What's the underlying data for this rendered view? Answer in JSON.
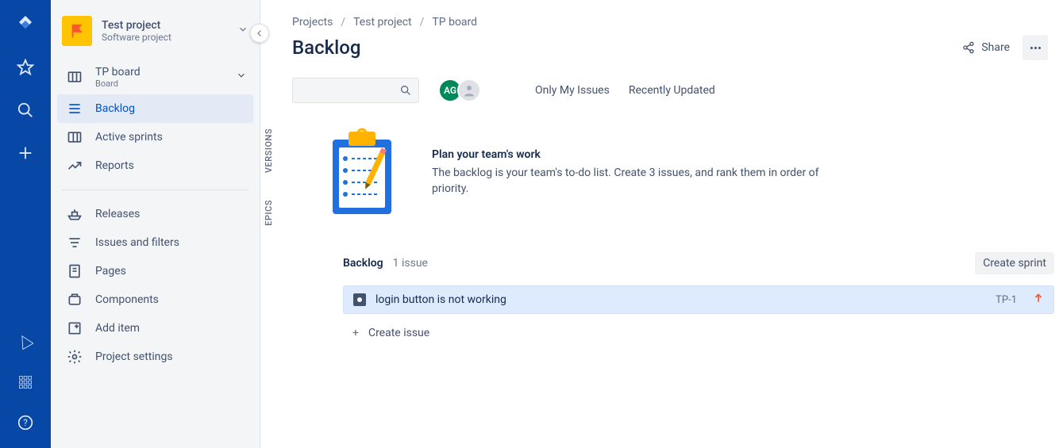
{
  "project": {
    "name": "Test project",
    "type": "Software project"
  },
  "board": {
    "name": "TP board",
    "type": "Board"
  },
  "sidebar": {
    "items": [
      {
        "label": "Backlog"
      },
      {
        "label": "Active sprints"
      },
      {
        "label": "Reports"
      }
    ],
    "secondary": [
      {
        "label": "Releases"
      },
      {
        "label": "Issues and filters"
      },
      {
        "label": "Pages"
      },
      {
        "label": "Components"
      },
      {
        "label": "Add item"
      },
      {
        "label": "Project settings"
      }
    ]
  },
  "breadcrumb": {
    "root": "Projects",
    "project": "Test project",
    "board": "TP board"
  },
  "page": {
    "title": "Backlog",
    "share": "Share"
  },
  "filters": {
    "onlyMine": "Only My Issues",
    "recent": "Recently Updated"
  },
  "avatar": {
    "initials": "AG"
  },
  "sideTabs": {
    "versions": "VERSIONS",
    "epics": "EPICS"
  },
  "promo": {
    "title": "Plan your team's work",
    "body": "The backlog is your team's to-do list. Create 3 issues, and rank them in order of priority."
  },
  "backlog": {
    "label": "Backlog",
    "count": "1 issue",
    "createSprint": "Create sprint",
    "createIssue": "Create issue",
    "issues": [
      {
        "title": "login button is not working",
        "key": "TP-1"
      }
    ]
  }
}
